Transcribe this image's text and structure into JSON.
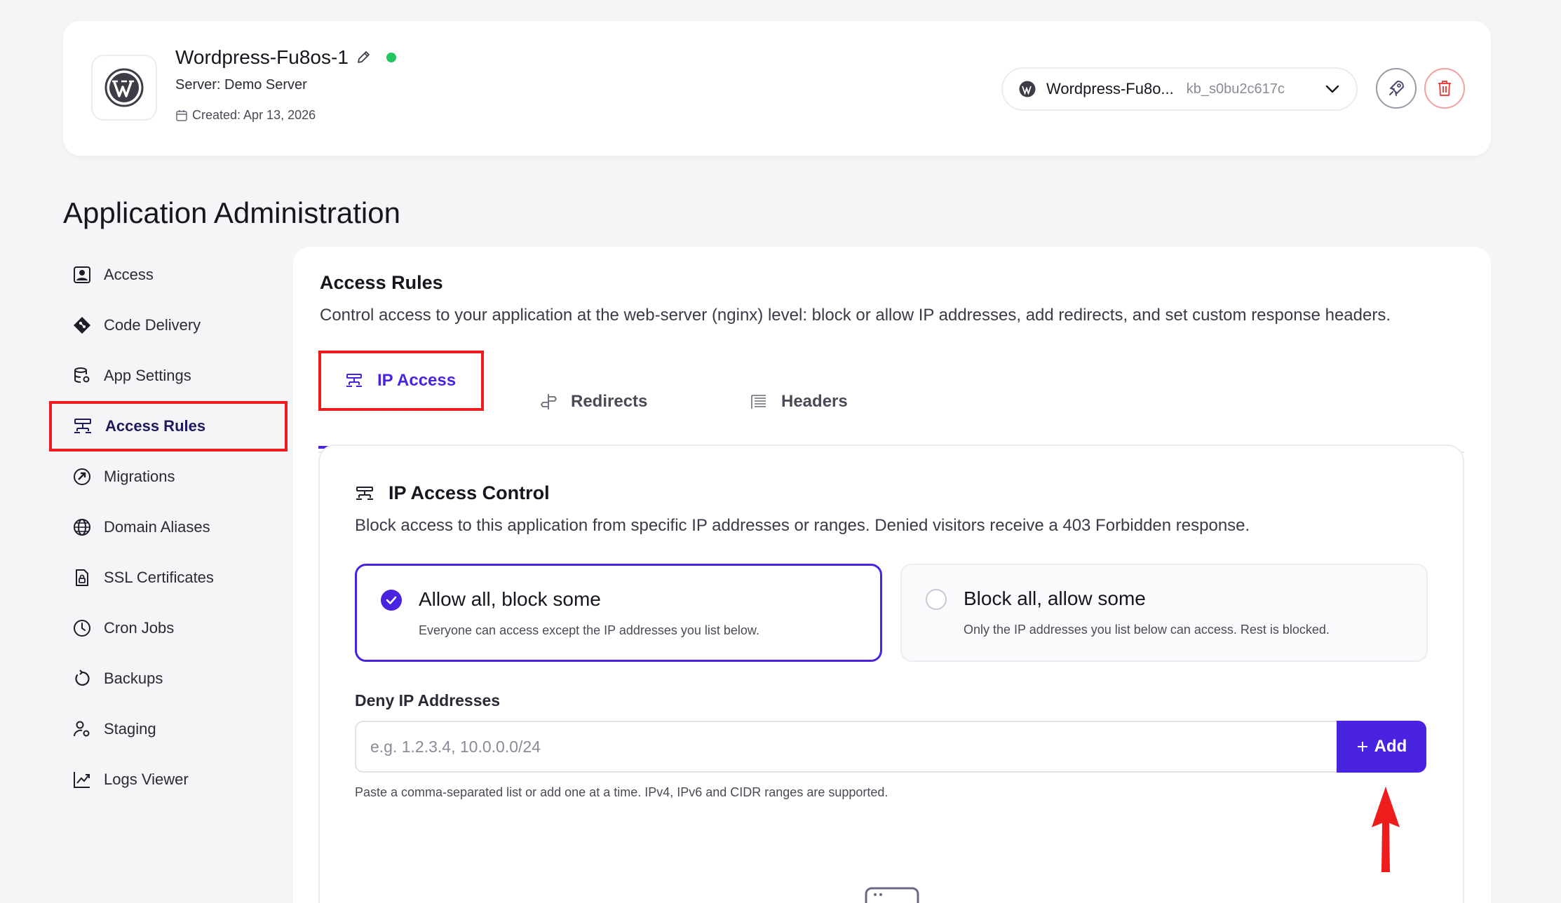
{
  "app": {
    "name": "Wordpress-Fu8os-1",
    "server": "Server: Demo Server",
    "created": "Created: Apr 13, 2026",
    "status_color": "#22c55e"
  },
  "app_selector": {
    "name": "Wordpress-Fu8o...",
    "id": "kb_s0bu2c617c"
  },
  "page": {
    "title": "Application Administration"
  },
  "sidebar": {
    "items": [
      {
        "label": "Access",
        "icon": "user-square-icon"
      },
      {
        "label": "Code Delivery",
        "icon": "git-diamond-icon"
      },
      {
        "label": "App Settings",
        "icon": "database-settings-icon"
      },
      {
        "label": "Access Rules",
        "icon": "network-icon",
        "active": true
      },
      {
        "label": "Migrations",
        "icon": "migrate-icon"
      },
      {
        "label": "Domain Aliases",
        "icon": "globe-icon"
      },
      {
        "label": "SSL Certificates",
        "icon": "certificate-lock-icon"
      },
      {
        "label": "Cron Jobs",
        "icon": "clock-icon"
      },
      {
        "label": "Backups",
        "icon": "refresh-icon"
      },
      {
        "label": "Staging",
        "icon": "user-gear-icon"
      },
      {
        "label": "Logs Viewer",
        "icon": "chart-line-icon"
      }
    ]
  },
  "main": {
    "title": "Access Rules",
    "description": "Control access to your application at the web-server (nginx) level: block or allow IP addresses, add redirects, and set custom response headers.",
    "tabs": [
      {
        "label": "IP Access",
        "active": true
      },
      {
        "label": "Redirects"
      },
      {
        "label": "Headers"
      }
    ]
  },
  "ip_access": {
    "title": "IP Access Control",
    "description": "Block access to this application from specific IP addresses or ranges. Denied visitors receive a 403 Forbidden response.",
    "modes": [
      {
        "title": "Allow all, block some",
        "subtitle": "Everyone can access except the IP addresses you list below.",
        "selected": true
      },
      {
        "title": "Block all, allow some",
        "subtitle": "Only the IP addresses you list below can access. Rest is blocked.",
        "selected": false
      }
    ],
    "deny_label": "Deny IP Addresses",
    "input_placeholder": "e.g. 1.2.3.4, 10.0.0.0/24",
    "input_value": "",
    "add_label": "Add",
    "hint": "Paste a comma-separated list or add one at a time. IPv4, IPv6 and CIDR ranges are supported."
  },
  "colors": {
    "accent": "#4a23e0",
    "highlight": "#ee1c1c",
    "danger": "#ef4444"
  }
}
